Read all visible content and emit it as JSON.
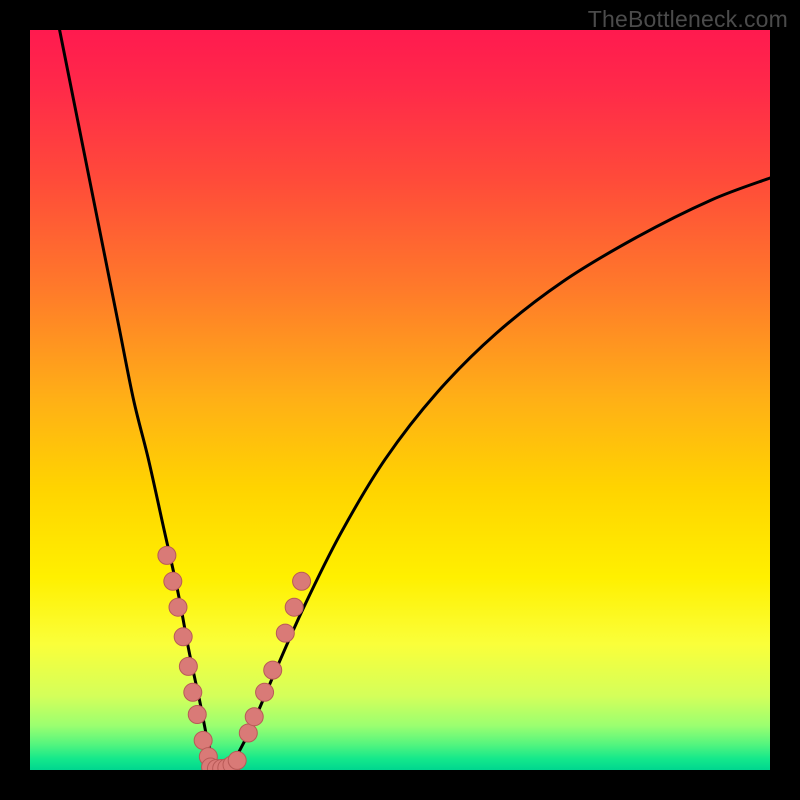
{
  "watermark": {
    "text": "TheBottleneck.com"
  },
  "colors": {
    "black": "#000000",
    "curve": "#000000",
    "marker_fill": "#d97a77",
    "marker_stroke": "#b85a57"
  },
  "gradient_stops": [
    {
      "offset": 0.0,
      "color": "#ff1a4f"
    },
    {
      "offset": 0.08,
      "color": "#ff2a49"
    },
    {
      "offset": 0.2,
      "color": "#ff4a3a"
    },
    {
      "offset": 0.35,
      "color": "#ff7a2a"
    },
    {
      "offset": 0.5,
      "color": "#ffb016"
    },
    {
      "offset": 0.62,
      "color": "#ffd400"
    },
    {
      "offset": 0.74,
      "color": "#fff000"
    },
    {
      "offset": 0.83,
      "color": "#faff3a"
    },
    {
      "offset": 0.9,
      "color": "#d4ff5a"
    },
    {
      "offset": 0.94,
      "color": "#9bff70"
    },
    {
      "offset": 0.965,
      "color": "#55f57e"
    },
    {
      "offset": 0.985,
      "color": "#14e88b"
    },
    {
      "offset": 1.0,
      "color": "#00d68f"
    }
  ],
  "chart_data": {
    "type": "line",
    "title": "",
    "xlabel": "",
    "ylabel": "",
    "xlim": [
      0,
      100
    ],
    "ylim": [
      0,
      100
    ],
    "series": [
      {
        "name": "bottleneck-curve",
        "x": [
          4,
          6,
          8,
          10,
          12,
          14,
          16,
          18,
          20,
          21.5,
          23,
          24,
          25,
          26,
          27,
          28,
          30,
          33,
          37,
          42,
          48,
          55,
          63,
          72,
          82,
          92,
          100
        ],
        "y": [
          100,
          90,
          80,
          70,
          60,
          50,
          42,
          33,
          24,
          16,
          9,
          4,
          1,
          0,
          0.5,
          2,
          6,
          13,
          22,
          32,
          42,
          51,
          59,
          66,
          72,
          77,
          80
        ]
      }
    ],
    "markers": [
      {
        "name": "left-cluster",
        "x": [
          18.5,
          19.3,
          20.0,
          20.7,
          21.4,
          22.0,
          22.6,
          23.4,
          24.1
        ],
        "y": [
          29.0,
          25.5,
          22.0,
          18.0,
          14.0,
          10.5,
          7.5,
          4.0,
          1.8
        ]
      },
      {
        "name": "bottom-cluster",
        "x": [
          24.4,
          25.2,
          25.9,
          26.6,
          27.3,
          28.0
        ],
        "y": [
          0.4,
          0.2,
          0.2,
          0.3,
          0.7,
          1.3
        ]
      },
      {
        "name": "right-cluster",
        "x": [
          29.5,
          30.3,
          31.7,
          32.8,
          34.5,
          35.7,
          36.7
        ],
        "y": [
          5.0,
          7.2,
          10.5,
          13.5,
          18.5,
          22.0,
          25.5
        ]
      }
    ]
  }
}
